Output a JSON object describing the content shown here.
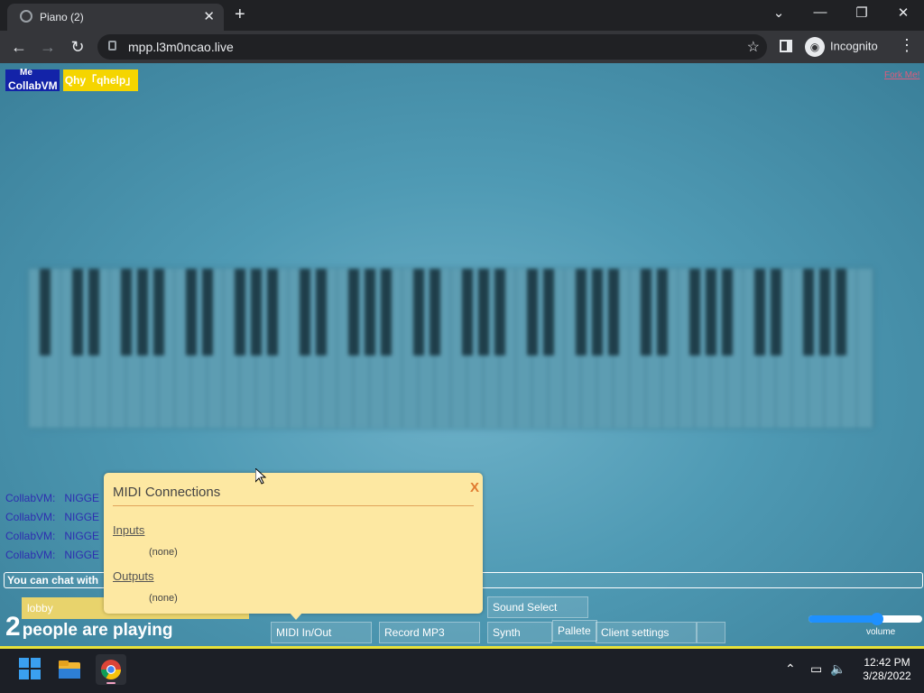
{
  "browser": {
    "tab_title": "Piano (2)",
    "url": "mpp.l3m0ncao.live",
    "incognito_label": "Incognito",
    "new_tab": "+",
    "tab_close": "✕",
    "minimize": "⌄",
    "restore": "—",
    "maximize": "❐",
    "close": "✕"
  },
  "page": {
    "collab_me": "Me",
    "collab_name": "CollabVM",
    "help_label": "Qhy「qhelp」",
    "fork_me": "Fork Me!",
    "chat": [
      {
        "nick": "CollabVM:",
        "msg": "NIGGE"
      },
      {
        "nick": "CollabVM:",
        "msg": "NIGGE"
      },
      {
        "nick": "CollabVM:",
        "msg": "NIGGE"
      },
      {
        "nick": "CollabVM:",
        "msg": "NIGGE"
      }
    ],
    "chat_placeholder": "You can chat with",
    "room": "lobby",
    "people_count": "2",
    "people_text": "people are playing",
    "buttons": {
      "midi": "MIDI In/Out",
      "record": "Record MP3",
      "sound_select": "Sound Select",
      "synth": "Synth",
      "pallete": "Pallete",
      "client_settings": "Client settings"
    },
    "volume_label": "volume",
    "volume_level": 0.6
  },
  "modal": {
    "title": "MIDI Connections",
    "close": "X",
    "inputs_label": "Inputs",
    "inputs_value": "(none)",
    "outputs_label": "Outputs",
    "outputs_value": "(none)"
  },
  "taskbar": {
    "time": "12:42 PM",
    "date": "3/28/2022"
  },
  "colors": {
    "page_bg": "#4f9ab4",
    "collab_blue": "#1323a8",
    "help_yellow": "#f5d500",
    "modal_bg": "#fde8a2",
    "chat_nick": "#2e2fb0"
  }
}
